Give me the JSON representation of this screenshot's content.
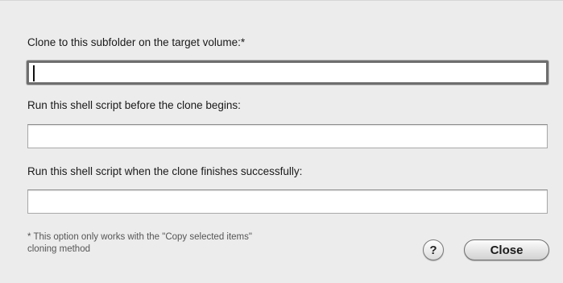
{
  "fields": [
    {
      "label": "Clone to this subfolder on the target volume:*",
      "value": ""
    },
    {
      "label": "Run this shell script before the clone begins:",
      "value": ""
    },
    {
      "label": "Run this shell script when the clone finishes successfully:",
      "value": ""
    }
  ],
  "footnote": {
    "line1": "* This option only works with the \"Copy selected items\"",
    "line2": "cloning method"
  },
  "buttons": {
    "help_label": "?",
    "help_icon": "question-mark-icon",
    "close_label": "Close"
  }
}
